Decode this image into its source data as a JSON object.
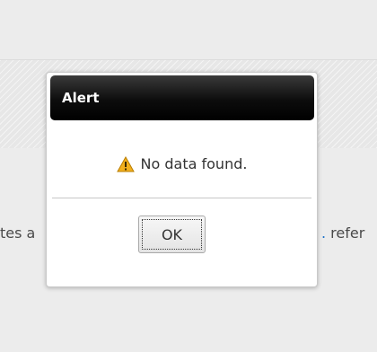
{
  "background": {
    "left_text": "tes a",
    "right_text_dot": ".",
    "right_text": " refer"
  },
  "dialog": {
    "title": "Alert",
    "message": "No data found.",
    "icon": "warning-icon",
    "ok_label": "OK"
  },
  "colors": {
    "titlebar": "#000000",
    "title_text": "#ffffff",
    "warning_fill": "#f2b01e",
    "link": "#1f74c9"
  }
}
